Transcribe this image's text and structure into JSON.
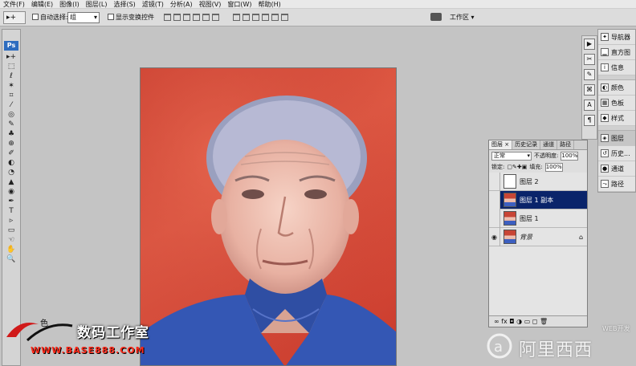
{
  "menu": [
    "文件(F)",
    "编辑(E)",
    "图像(I)",
    "图层(L)",
    "选择(S)",
    "滤镜(T)",
    "分析(A)",
    "视图(V)",
    "窗口(W)",
    "帮助(H)"
  ],
  "options": {
    "tool_glyph": "▸+",
    "auto_select_label": "自动选择:",
    "auto_select_value": "组",
    "show_transform_label": "显示变换控件",
    "workspace_label": "工作区 ▾"
  },
  "toolbox": {
    "logo": "Ps",
    "tools": [
      "▸+",
      "⬚",
      "ℓ",
      "✶",
      "⌗",
      "⁄",
      "◎",
      "✎",
      "♣",
      "⊕",
      "✐",
      "◐",
      "◔",
      "▲",
      "◉",
      "✒",
      "T",
      "▹",
      "▭",
      "☜",
      "✋",
      "🔍"
    ]
  },
  "right_panels": [
    {
      "label": "导航器",
      "icon": "navigator-icon"
    },
    {
      "label": "直方图",
      "icon": "histogram-icon"
    },
    {
      "label": "信息",
      "icon": "info-icon"
    },
    {
      "label": "颜色",
      "icon": "color-icon"
    },
    {
      "label": "色板",
      "icon": "swatches-icon"
    },
    {
      "label": "样式",
      "icon": "styles-icon"
    },
    {
      "label": "图层",
      "icon": "layers-icon"
    },
    {
      "label": "历史...",
      "icon": "history-icon"
    },
    {
      "label": "通道",
      "icon": "channels-icon"
    },
    {
      "label": "路径",
      "icon": "paths-icon"
    }
  ],
  "layers_panel": {
    "tabs": [
      "图层 ×",
      "历史记录",
      "通道",
      "路径"
    ],
    "blend_mode": "正常",
    "opacity_label": "不透明度:",
    "opacity_value": "100%",
    "lock_label": "锁定:",
    "fill_label": "填充:",
    "fill_value": "100%",
    "layers": [
      {
        "name": "图层 2",
        "visible": false,
        "selected": false,
        "thumb": "white"
      },
      {
        "name": "图层 1 副本",
        "visible": false,
        "selected": true,
        "thumb": "photo"
      },
      {
        "name": "图层 1",
        "visible": false,
        "selected": false,
        "thumb": "photo"
      },
      {
        "name": "背景",
        "visible": true,
        "selected": false,
        "thumb": "photo",
        "locked": true
      }
    ],
    "bottom_icons": "∞ fx ◘ ◑ ▭ ◻ 🗑"
  },
  "watermarks": {
    "title": "数码工作室",
    "url": "WWW.BASE888.COM",
    "se": "色",
    "right_cn": "阿里西西",
    "web": "WEB开发"
  }
}
